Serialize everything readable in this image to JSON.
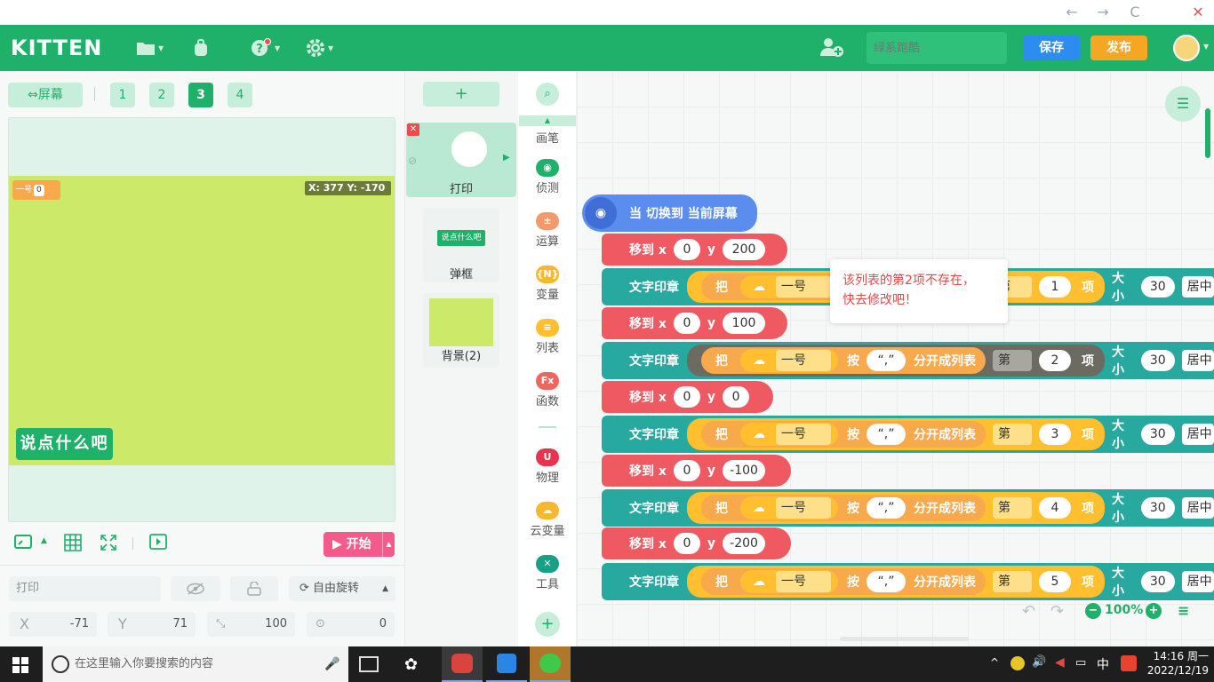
{
  "window": {
    "back": "←",
    "forward": "→",
    "refresh": "C",
    "close": "✕"
  },
  "header": {
    "logo": "KITTEN",
    "project_name_placeholder": "绿系跑酷",
    "save": "保存",
    "publish": "发布"
  },
  "colors": {
    "brand": "#1fb06a",
    "save": "#2d8cf0",
    "publish": "#f5a623",
    "start": "#f25b8c",
    "motion": "#ef5a62",
    "looks": "#28a9a0",
    "list": "#ffbf2f",
    "text_op": "#f7a94b"
  },
  "stage": {
    "screen_btn": "屏幕",
    "screens": [
      "1",
      "2",
      "3",
      "4"
    ],
    "active_screen": "3",
    "coord_label": "X: 377   Y: -170",
    "sprite_tag": "一号",
    "sprite_tag_value": "0",
    "say_button": "说点什么吧",
    "start": "开始"
  },
  "props": {
    "name": "打印",
    "rotation": "自由旋转",
    "x_label": "X",
    "x": "-71",
    "y_label": "Y",
    "y": "71",
    "size": "100",
    "direction": "0"
  },
  "sprites": {
    "add": "+",
    "items": [
      {
        "label": "打印"
      },
      {
        "label": "弹框",
        "thumb_text": "说点什么吧"
      },
      {
        "label": "背景(2)"
      }
    ]
  },
  "categories": [
    {
      "label": "画笔",
      "icon": "pen-icon"
    },
    {
      "label": "侦测",
      "icon": "sensing-icon",
      "glyph": "◉",
      "color": "#1fb06a"
    },
    {
      "label": "运算",
      "icon": "operator-icon",
      "glyph": "±",
      "color": "#f29a6b"
    },
    {
      "label": "变量",
      "icon": "variable-icon",
      "glyph": "{N}",
      "color": "#f7b731"
    },
    {
      "label": "列表",
      "icon": "list-icon",
      "glyph": "≡",
      "color": "#ffbf2f"
    },
    {
      "label": "函数",
      "icon": "function-icon",
      "glyph": "Fx",
      "color": "#f0665e"
    },
    {
      "label": "物理",
      "icon": "physics-icon",
      "glyph": "U",
      "color": "#e8334f"
    },
    {
      "label": "云变量",
      "icon": "cloud-variable-icon",
      "glyph": "☁",
      "color": "#f7b731"
    },
    {
      "label": "工具",
      "icon": "tools-icon",
      "glyph": "✕",
      "color": "#16a085"
    }
  ],
  "script": {
    "hat": "当 切换到 当前屏幕",
    "move_label": "移到 x",
    "y_label": "y",
    "print_label": "文字印章",
    "take": "把",
    "var_name": "一号",
    "split_by": "按",
    "separator": "“,”",
    "split_into": "分开成列表",
    "nth": "第",
    "item": "项",
    "size_label": "大小",
    "size_value": "30",
    "align": "居中",
    "rows": [
      {
        "x": "0",
        "y": "200",
        "index": "1"
      },
      {
        "x": "0",
        "y": "100",
        "index": "2"
      },
      {
        "x": "0",
        "y": "0",
        "index": "3"
      },
      {
        "x": "0",
        "y": "-100",
        "index": "4"
      },
      {
        "x": "0",
        "y": "-200",
        "index": "5"
      }
    ]
  },
  "tooltip": {
    "line1": "该列表的第2项不存在，",
    "line2": "快去修改吧！"
  },
  "zoom": "100%",
  "taskbar": {
    "search_placeholder": "在这里输入你要搜索的内容",
    "ime": "中",
    "time": "14:16 周一",
    "date": "2022/12/19"
  }
}
